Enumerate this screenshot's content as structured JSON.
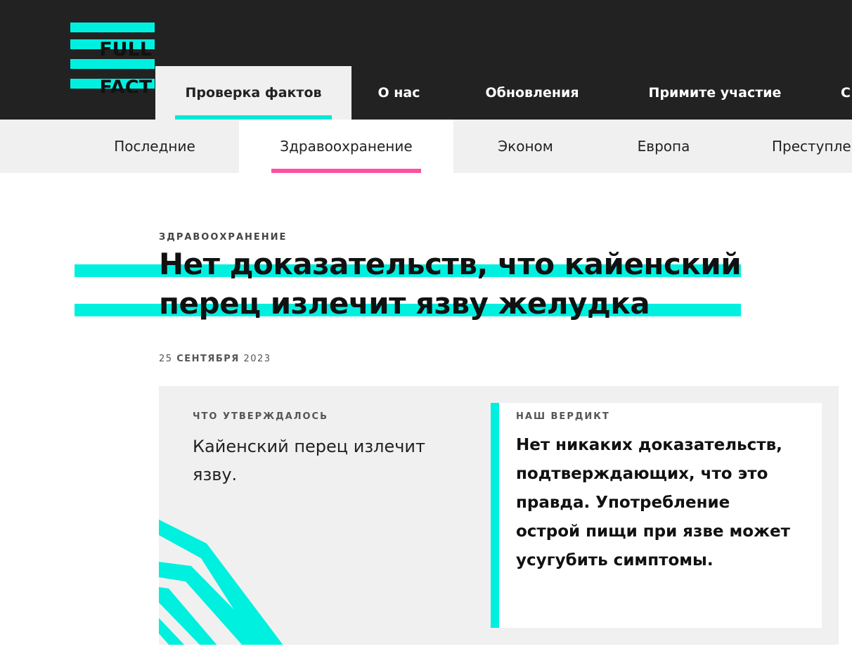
{
  "header": {
    "logo": {
      "line1": "FULL",
      "line2": "FACT",
      "accent": "#00f0e0"
    },
    "nav": [
      {
        "label": "Проверка фактов",
        "active": true
      },
      {
        "label": "О нас",
        "active": false
      },
      {
        "label": "Обновления",
        "active": false
      },
      {
        "label": "Примите участие",
        "active": false
      },
      {
        "label": "С",
        "active": false
      }
    ]
  },
  "subnav": [
    {
      "label": "Последние",
      "active": false
    },
    {
      "label": "Здравоохранение",
      "active": true
    },
    {
      "label": "Эконом",
      "active": false
    },
    {
      "label": "Европа",
      "active": false
    },
    {
      "label": "Преступле",
      "active": false
    }
  ],
  "article": {
    "category": "ЗДРАВООХРАНЕНИЕ",
    "title_line1": "Нет доказательств, что кайенский",
    "title_line2": "перец излечит язву желудка",
    "date_day": "25",
    "date_month": "СЕНТЯБРЯ",
    "date_year": "2023"
  },
  "factcheck": {
    "claim_label": "ЧТО УТВЕРЖДАЛОСЬ",
    "claim_text": "Кайенский перец излечит язву.",
    "verdict_label": "НАШ ВЕРДИКТ",
    "verdict_text": "Нет никаких доказательств, подтверждающих, что это правда. Употребление острой пищи при язве может усугубить симптомы."
  },
  "colors": {
    "header_bg": "#222222",
    "accent_cyan": "#00f0e0",
    "accent_pink": "#ff4fa3",
    "subnav_bg": "#f0f0f0"
  }
}
